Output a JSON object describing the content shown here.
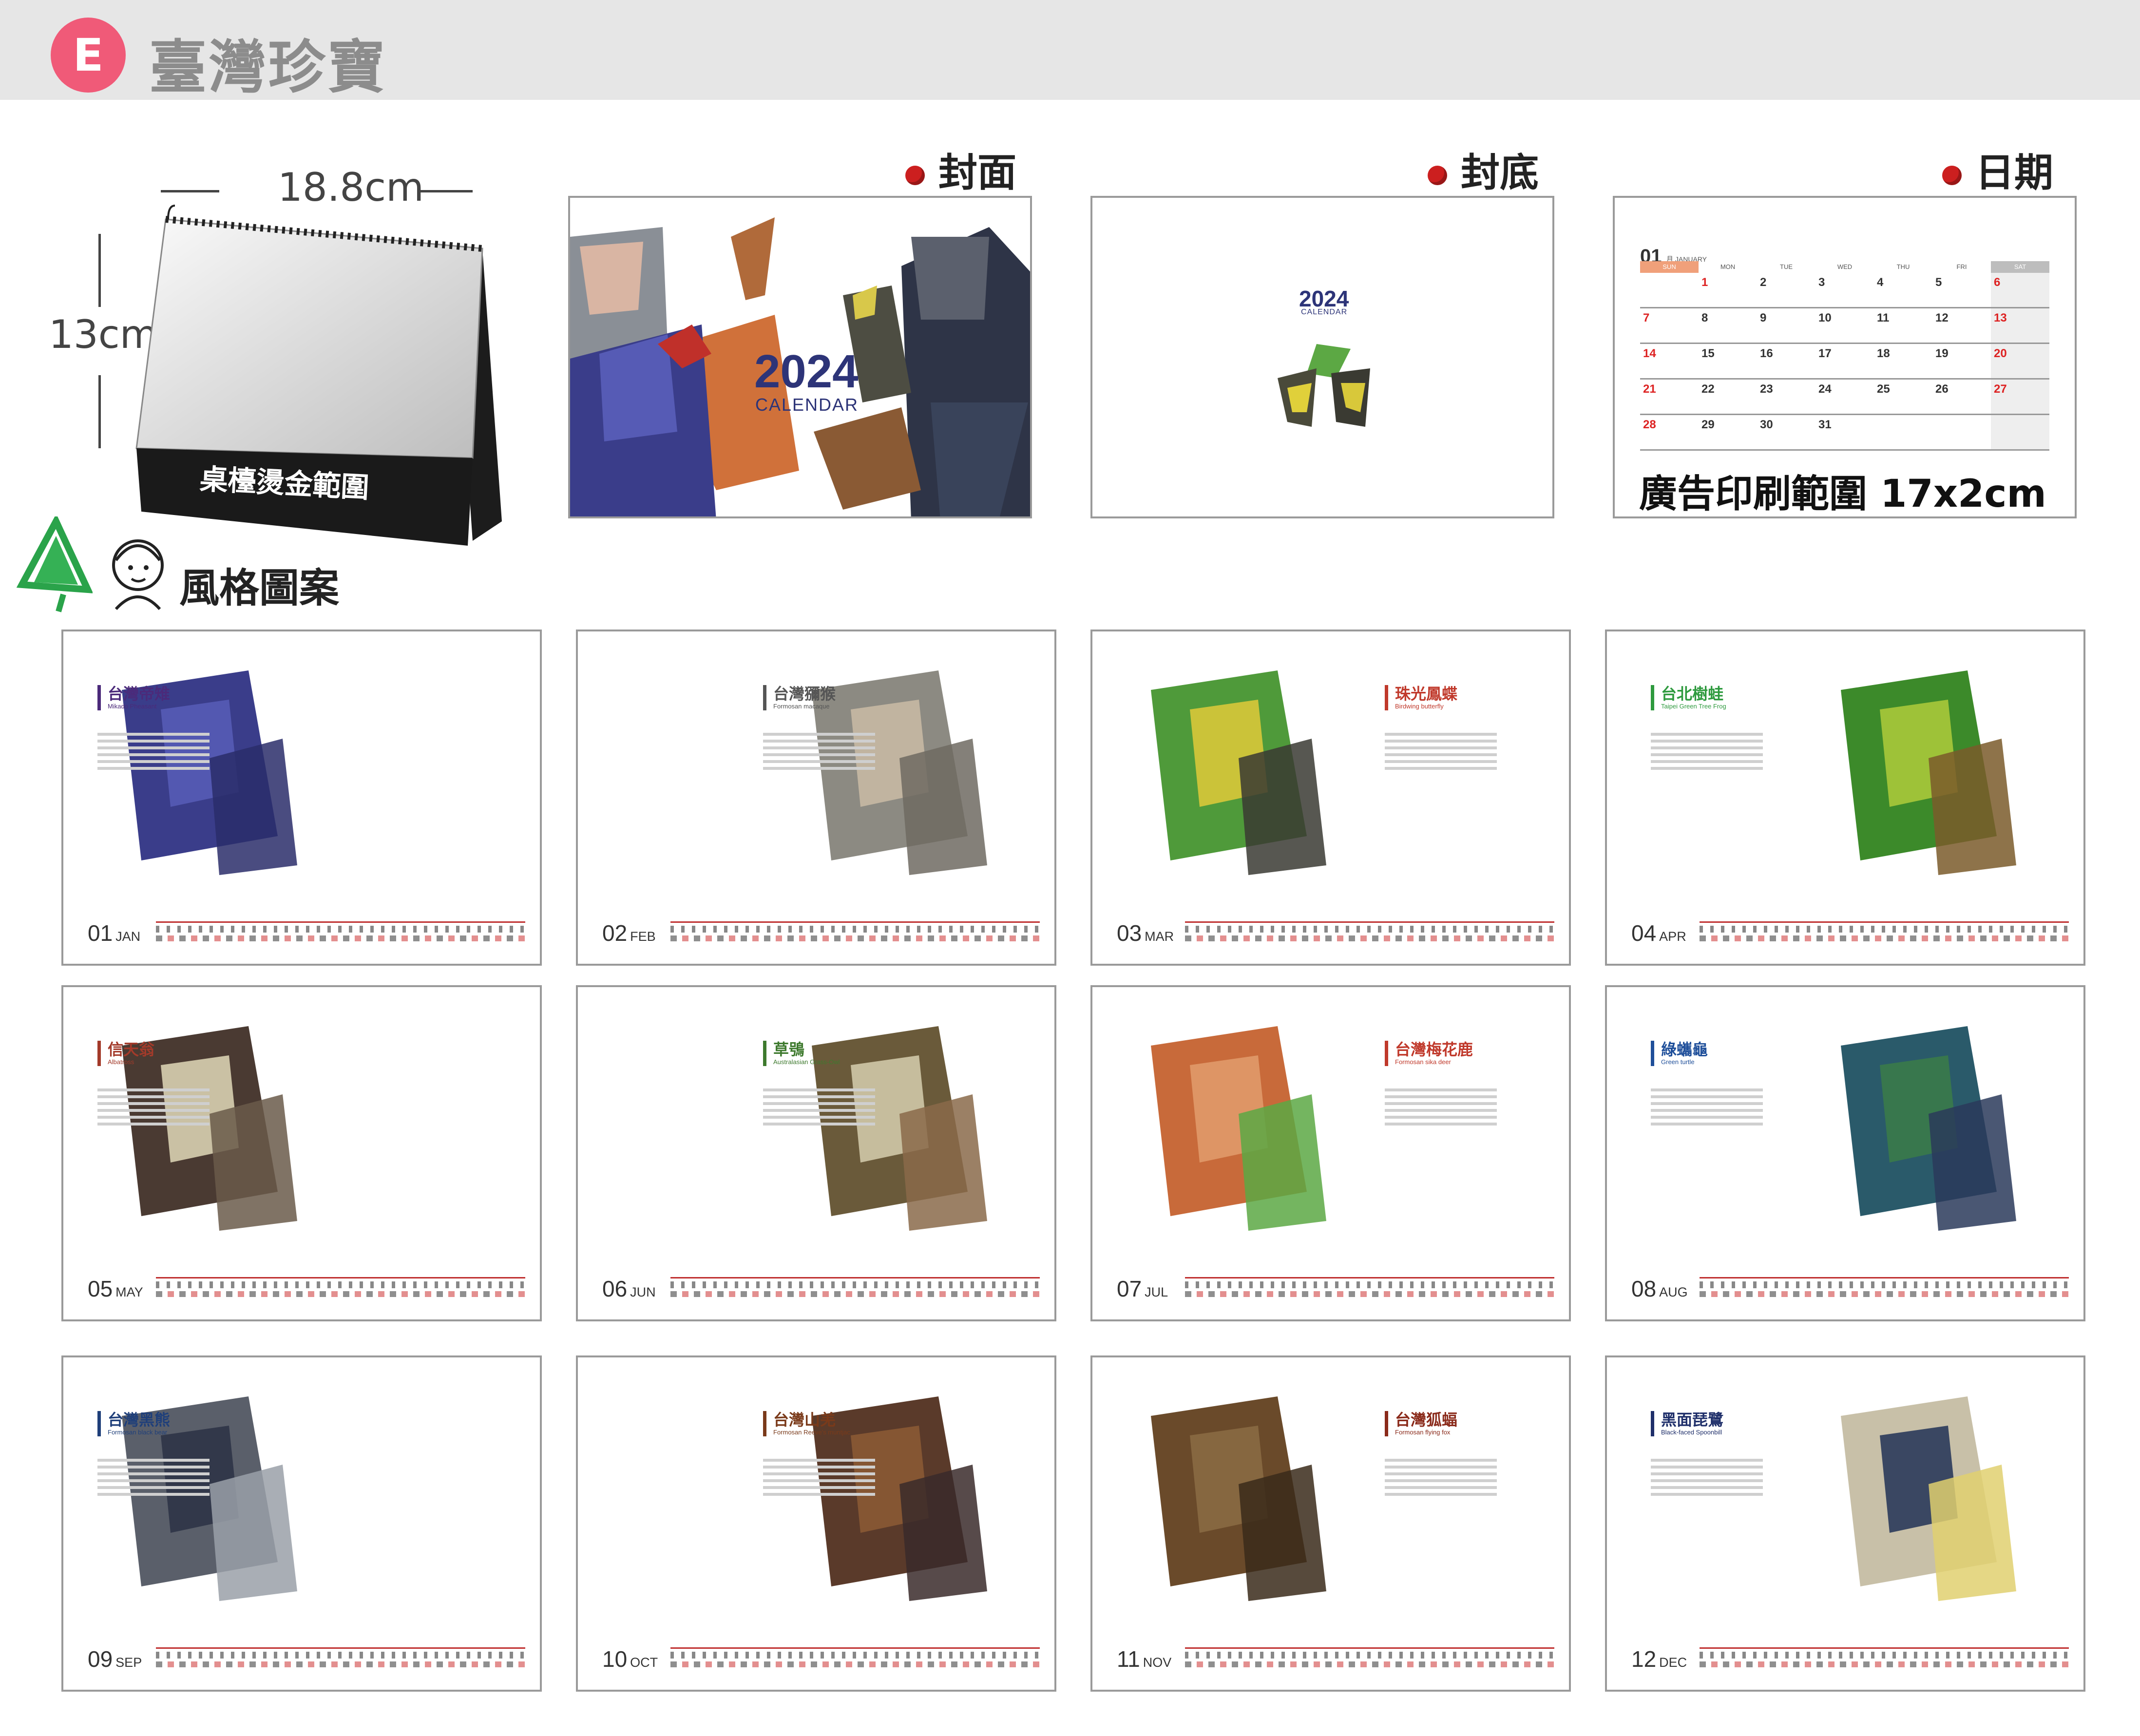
{
  "header": {
    "badge": "E",
    "title": "臺灣珍寶"
  },
  "mockup": {
    "width_label": "18.8cm",
    "height_label": "13cm",
    "base_text": "桌檯燙金範圍"
  },
  "panels": {
    "cover_label": "封面",
    "back_label": "封底",
    "date_label": "日期"
  },
  "cover": {
    "year": "2024",
    "sub": "CALENDAR"
  },
  "back": {
    "year": "2024",
    "sub": "CALENDAR"
  },
  "date_page": {
    "month": "01",
    "month_suffix": "月 JANUARY",
    "weekdays": [
      "SUN",
      "MON",
      "TUE",
      "WED",
      "THU",
      "FRI",
      "SAT"
    ],
    "weeks": [
      [
        "",
        "1",
        "2",
        "3",
        "4",
        "5",
        "6"
      ],
      [
        "7",
        "8",
        "9",
        "10",
        "11",
        "12",
        "13"
      ],
      [
        "14",
        "15",
        "16",
        "17",
        "18",
        "19",
        "20"
      ],
      [
        "21",
        "22",
        "23",
        "24",
        "25",
        "26",
        "27"
      ],
      [
        "28",
        "29",
        "30",
        "31",
        "",
        "",
        ""
      ]
    ],
    "ad_label": "廣告印刷範圍 17x2cm"
  },
  "style_label": "風格圖案",
  "months": [
    {
      "num": "01",
      "abbr": "JAN",
      "cn": "台灣帝雉",
      "en": "Mikado Pheasant",
      "color": "#4b2a7a"
    },
    {
      "num": "02",
      "abbr": "FEB",
      "cn": "台灣獼猴",
      "en": "Formosan macaque",
      "color": "#555555"
    },
    {
      "num": "03",
      "abbr": "MAR",
      "cn": "珠光鳳蝶",
      "en": "Birdwing butterfly",
      "color": "#c0392b"
    },
    {
      "num": "04",
      "abbr": "APR",
      "cn": "台北樹蛙",
      "en": "Taipei Green Tree Frog",
      "color": "#2e9a3e"
    },
    {
      "num": "05",
      "abbr": "MAY",
      "cn": "信天翁",
      "en": "Albatross",
      "color": "#a33a2a"
    },
    {
      "num": "06",
      "abbr": "JUN",
      "cn": "草鴞",
      "en": "Australasian Grass-Owl",
      "color": "#3e7a2e"
    },
    {
      "num": "07",
      "abbr": "JUL",
      "cn": "台灣梅花鹿",
      "en": "Formosan sika deer",
      "color": "#c0392b"
    },
    {
      "num": "08",
      "abbr": "AUG",
      "cn": "綠蠵龜",
      "en": "Green turtle",
      "color": "#1f4f9a"
    },
    {
      "num": "09",
      "abbr": "SEP",
      "cn": "台灣黑熊",
      "en": "Formosan black bear",
      "color": "#1f3f7a"
    },
    {
      "num": "10",
      "abbr": "OCT",
      "cn": "台灣山羌",
      "en": "Formosan Reeve's muntjac",
      "color": "#7a3a1a"
    },
    {
      "num": "11",
      "abbr": "NOV",
      "cn": "台灣狐蝠",
      "en": "Formosan flying fox",
      "color": "#8a2a1a"
    },
    {
      "num": "12",
      "abbr": "DEC",
      "cn": "黑面琵鷺",
      "en": "Black-faced Spoonbill",
      "color": "#1f2f6a"
    }
  ]
}
